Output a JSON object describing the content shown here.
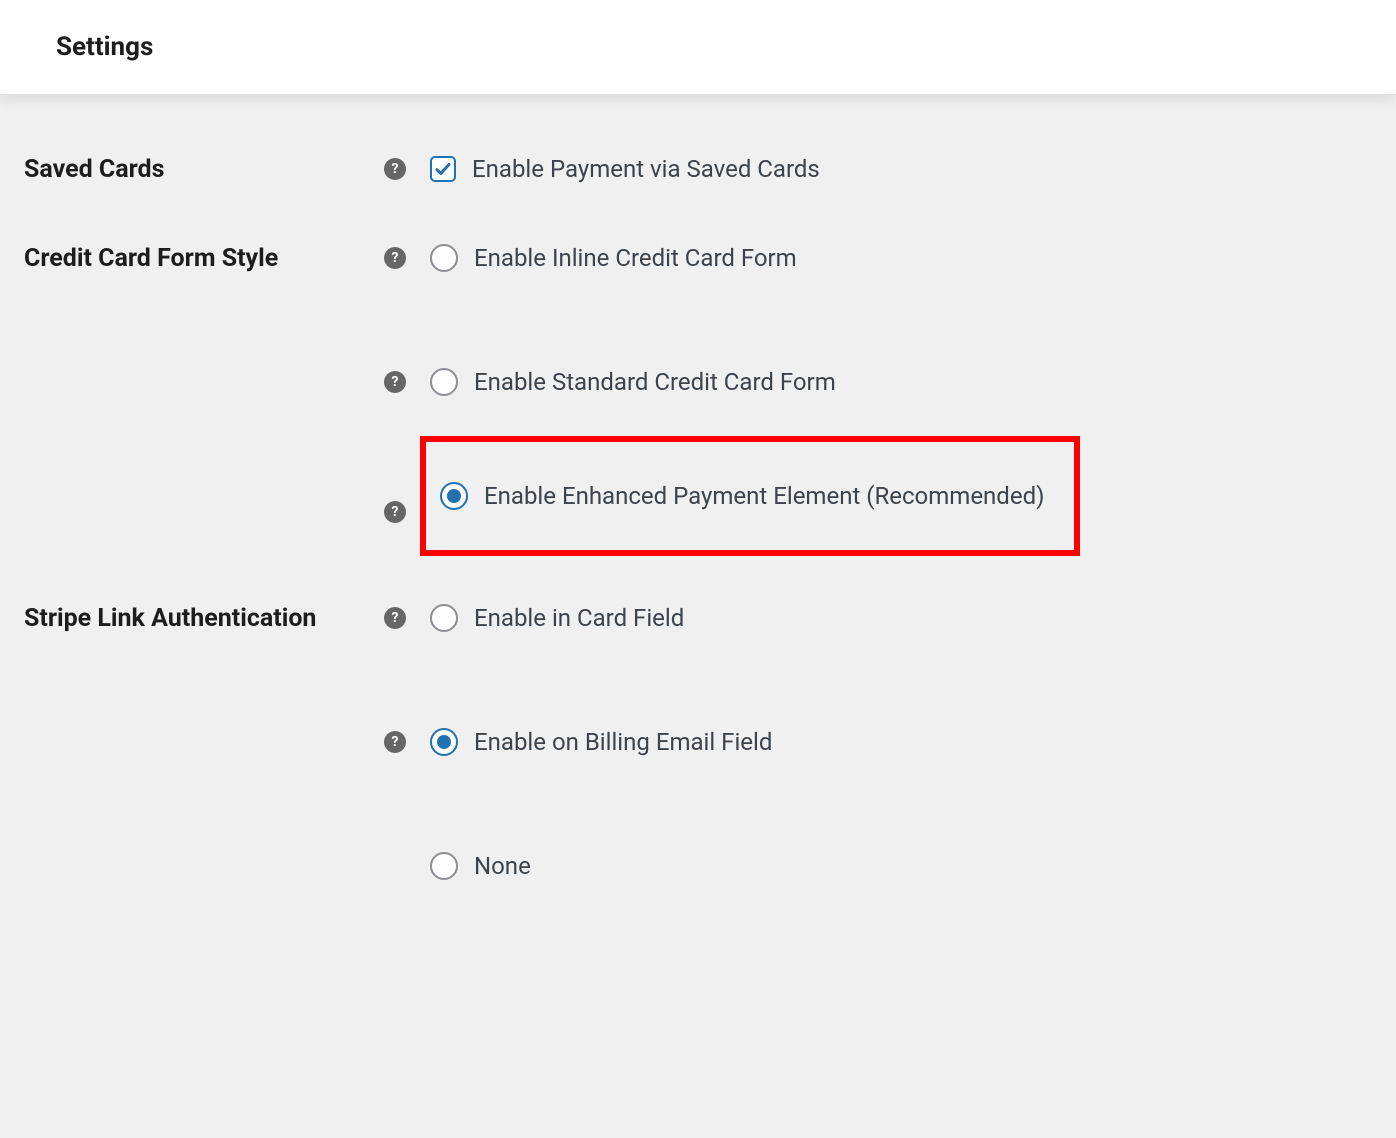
{
  "header": {
    "title": "Settings"
  },
  "sections": {
    "savedCards": {
      "label": "Saved Cards",
      "option": {
        "text": "Enable Payment via Saved Cards",
        "checked": true
      }
    },
    "creditCardFormStyle": {
      "label": "Credit Card Form Style",
      "options": {
        "inline": {
          "text": "Enable Inline Credit Card Form",
          "selected": false
        },
        "standard": {
          "text": "Enable Standard Credit Card Form",
          "selected": false
        },
        "enhanced": {
          "text": "Enable Enhanced Payment Element (Recommended)",
          "selected": true,
          "highlighted": true
        }
      }
    },
    "stripeLink": {
      "label": "Stripe Link Authentication",
      "options": {
        "cardField": {
          "text": "Enable in Card Field",
          "selected": false
        },
        "billingEmail": {
          "text": "Enable on Billing Email Field",
          "selected": true
        },
        "none": {
          "text": "None",
          "selected": false
        }
      }
    }
  }
}
